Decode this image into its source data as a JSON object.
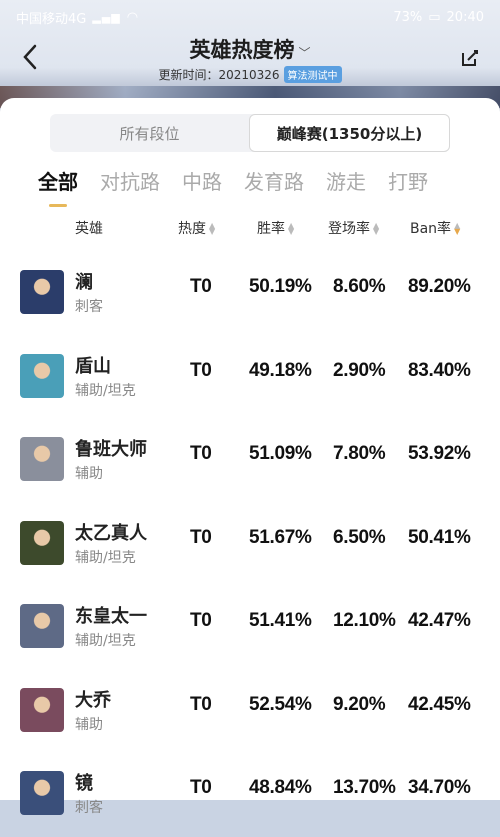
{
  "status_bar": {
    "carrier": "中国移动4G",
    "battery": "73%",
    "time": "20:40"
  },
  "header": {
    "title": "英雄热度榜",
    "updated_label": "更新时间：",
    "updated_date": "20210326",
    "badge": "算法测试中"
  },
  "segment": {
    "options": [
      "所有段位",
      "巅峰赛(1350分以上)"
    ],
    "selected_index": 1
  },
  "tabs": {
    "items": [
      "全部",
      "对抗路",
      "中路",
      "发育路",
      "游走",
      "打野"
    ],
    "active_index": 0
  },
  "table": {
    "headers": {
      "hero": "英雄",
      "heat": "热度",
      "winrate": "胜率",
      "pickrate": "登场率",
      "banrate": "Ban率"
    },
    "sorted_by": "banrate",
    "rows": [
      {
        "name": "澜",
        "role": "刺客",
        "heat": "T0",
        "winrate": "50.19%",
        "pickrate": "8.60%",
        "banrate": "89.20%",
        "avatar_color": "#2b3d6a"
      },
      {
        "name": "盾山",
        "role": "辅助/坦克",
        "heat": "T0",
        "winrate": "49.18%",
        "pickrate": "2.90%",
        "banrate": "83.40%",
        "avatar_color": "#4a9fb8"
      },
      {
        "name": "鲁班大师",
        "role": "辅助",
        "heat": "T0",
        "winrate": "51.09%",
        "pickrate": "7.80%",
        "banrate": "53.92%",
        "avatar_color": "#8a8f9c"
      },
      {
        "name": "太乙真人",
        "role": "辅助/坦克",
        "heat": "T0",
        "winrate": "51.67%",
        "pickrate": "6.50%",
        "banrate": "50.41%",
        "avatar_color": "#3d4a2c"
      },
      {
        "name": "东皇太一",
        "role": "辅助/坦克",
        "heat": "T0",
        "winrate": "51.41%",
        "pickrate": "12.10%",
        "banrate": "42.47%",
        "avatar_color": "#5e6a86"
      },
      {
        "name": "大乔",
        "role": "辅助",
        "heat": "T0",
        "winrate": "52.54%",
        "pickrate": "9.20%",
        "banrate": "42.45%",
        "avatar_color": "#7a4b5e"
      },
      {
        "name": "镜",
        "role": "刺客",
        "heat": "T0",
        "winrate": "48.84%",
        "pickrate": "13.70%",
        "banrate": "34.70%",
        "avatar_color": "#3a4f7a"
      }
    ]
  }
}
